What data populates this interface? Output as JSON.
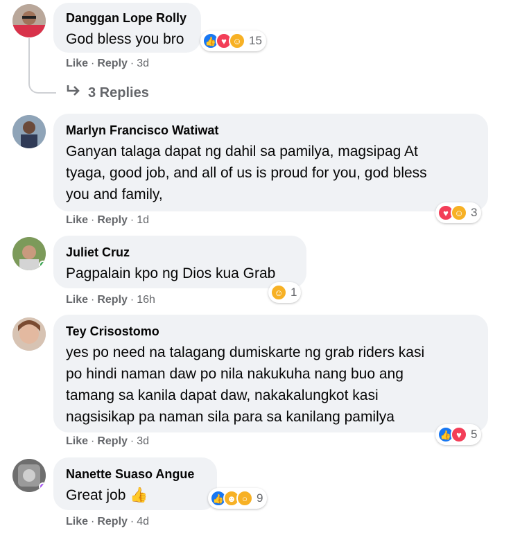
{
  "comments": [
    {
      "author": "Danggan Lope Rolly",
      "text": "God bless you bro",
      "reaction_count": "15",
      "reactions": [
        "like-icon",
        "love-icon",
        "care-icon"
      ],
      "like": "Like",
      "reply": "Reply",
      "time": "3d",
      "replies_label": "3 Replies"
    },
    {
      "author": "Marlyn Francisco Watiwat",
      "text_lines": [
        "Ganyan talaga dapat ng dahil sa pamilya, magsipag At",
        "tyaga, good job, and all of us is proud for you, god bless",
        "you and family,"
      ],
      "reaction_count": "3",
      "reactions": [
        "love-icon",
        "care-icon"
      ],
      "like": "Like",
      "reply": "Reply",
      "time": "1d"
    },
    {
      "author": "Juliet Cruz",
      "text": "Pagpalain kpo ng Dios kua Grab",
      "reaction_count": "1",
      "reactions": [
        "care-icon"
      ],
      "like": "Like",
      "reply": "Reply",
      "time": "16h"
    },
    {
      "author": "Tey Crisostomo",
      "text_lines": [
        "yes po need na talagang dumiskarte ng grab riders kasi",
        "po hindi naman daw po nila nakukuha nang buo ang",
        "tamang sa kanila dapat daw, nakakalungkot kasi",
        "nagsisikap pa naman sila para sa kanilang pamilya"
      ],
      "reaction_count": "5",
      "reactions": [
        "like-icon",
        "love-icon"
      ],
      "like": "Like",
      "reply": "Reply",
      "time": "3d"
    },
    {
      "author": "Nanette Suaso Angue",
      "text": "Great job 👍",
      "reaction_count": "9",
      "reactions": [
        "like-icon",
        "haha-icon",
        "wow-icon"
      ],
      "like": "Like",
      "reply": "Reply",
      "time": "4d"
    }
  ],
  "separator": "·",
  "colors": {
    "bubble": "#f0f2f5",
    "meta_text": "#65676b",
    "like_blue": "#1877f2",
    "love_red": "#f33e58",
    "care_yellow": "#f7b125",
    "presence_green": "#31a24c"
  }
}
